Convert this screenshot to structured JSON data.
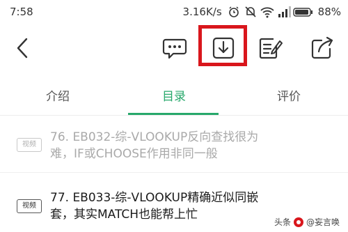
{
  "status_bar": {
    "time": "7:58",
    "net_speed": "3.16K/s",
    "battery": "88%",
    "icons": [
      "alarm-icon",
      "mute-icon",
      "wifi-icon",
      "signal-icon",
      "battery-icon"
    ]
  },
  "toolbar": {
    "icons": [
      "back-icon",
      "comment-icon",
      "download-icon",
      "notes-icon",
      "share-icon"
    ],
    "highlight_color": "#d9161c"
  },
  "tabs": [
    {
      "label": "介绍",
      "active": false
    },
    {
      "label": "目录",
      "active": true
    },
    {
      "label": "评价",
      "active": false
    }
  ],
  "accent_color": "#27a86b",
  "list": [
    {
      "badge": "视频",
      "title": "76. EB032-综-VLOOKUP反向查找很为难，IF或CHOOSE作用非同一般",
      "dimmed": true
    },
    {
      "badge": "视频",
      "title": "77. EB033-综-VLOOKUP精确近似同嵌套，其实MATCH也能帮上忙",
      "dimmed": false
    }
  ],
  "watermark": {
    "prefix": "头条",
    "handle": "@妄言唤"
  }
}
